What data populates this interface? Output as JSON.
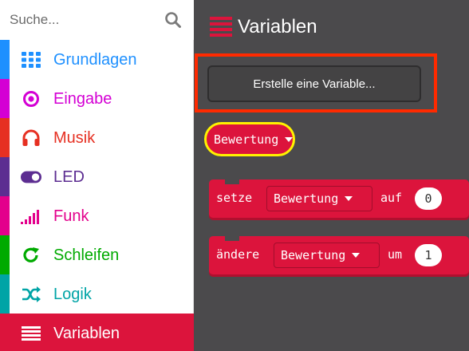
{
  "search": {
    "placeholder": "Suche..."
  },
  "categories": [
    {
      "id": "basic",
      "label": "Grundlagen",
      "color": "#1e90ff",
      "icon": "grid-icon"
    },
    {
      "id": "input",
      "label": "Eingabe",
      "color": "#d400d4",
      "icon": "target-icon"
    },
    {
      "id": "music",
      "label": "Musik",
      "color": "#e63022",
      "icon": "headphones-icon"
    },
    {
      "id": "led",
      "label": "LED",
      "color": "#5c2d91",
      "icon": "toggle-icon"
    },
    {
      "id": "radio",
      "label": "Funk",
      "color": "#e3008c",
      "icon": "signal-bars-icon"
    },
    {
      "id": "loops",
      "label": "Schleifen",
      "color": "#00aa00",
      "icon": "refresh-icon"
    },
    {
      "id": "logic",
      "label": "Logik",
      "color": "#00a4a6",
      "icon": "shuffle-icon"
    },
    {
      "id": "variables",
      "label": "Variablen",
      "color": "#dc143c",
      "icon": "list-icon",
      "selected": true
    }
  ],
  "flyout": {
    "title": "Variablen",
    "create_button": "Erstelle eine Variable...",
    "variable_name": "Bewertung",
    "blocks": [
      {
        "keyword": "setze",
        "variable": "Bewertung",
        "preposition": "auf",
        "value": "0"
      },
      {
        "keyword": "ändere",
        "variable": "Bewertung",
        "preposition": "um",
        "value": "1"
      }
    ]
  },
  "colors": {
    "flyout_bg": "#4b4a4c",
    "variables": "#dc143c",
    "highlight_box": "#ff2a00",
    "highlight_circle": "#fff200"
  }
}
